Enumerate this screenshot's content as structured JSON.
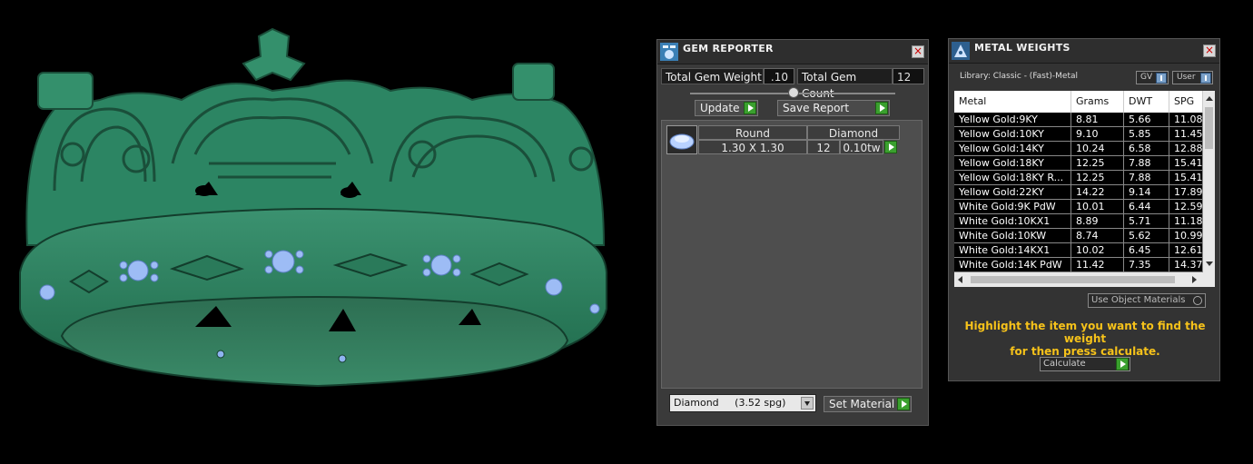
{
  "gem_reporter": {
    "title": "GEM REPORTER",
    "total_weight_label": "Total Gem Weight",
    "total_weight_value": ".10",
    "total_count_label": "Total Gem Count",
    "total_count_value": "12",
    "update_label": "Update",
    "save_report_label": "Save Report",
    "headers": [
      "Round",
      "Diamond"
    ],
    "row": {
      "size": "1.30 X 1.30",
      "count": "12",
      "weight": "0.10tw"
    },
    "material_select": "Diamond     (3.52 spg)",
    "set_material_label": "Set Material"
  },
  "metal_weights": {
    "title": "METAL WEIGHTS",
    "library_label": "Library: Classic - (Fast)-Metal",
    "gv_label": "GV",
    "user_label": "User",
    "columns": [
      "Metal",
      "Grams",
      "DWT",
      "SPG"
    ],
    "rows": [
      [
        "Yellow Gold:9KY",
        "8.81",
        "5.66",
        "11.08"
      ],
      [
        "Yellow Gold:10KY",
        "9.10",
        "5.85",
        "11.45"
      ],
      [
        "Yellow Gold:14KY",
        "10.24",
        "6.58",
        "12.88"
      ],
      [
        "Yellow Gold:18KY",
        "12.25",
        "7.88",
        "15.41"
      ],
      [
        "Yellow Gold:18KY R...",
        "12.25",
        "7.88",
        "15.41"
      ],
      [
        "Yellow Gold:22KY",
        "14.22",
        "9.14",
        "17.89"
      ],
      [
        "White Gold:9K PdW",
        "10.01",
        "6.44",
        "12.59"
      ],
      [
        "White Gold:10KX1",
        "8.89",
        "5.71",
        "11.18"
      ],
      [
        "White Gold:10KW",
        "8.74",
        "5.62",
        "10.99"
      ],
      [
        "White Gold:14KX1",
        "10.02",
        "6.45",
        "12.61"
      ],
      [
        "White Gold:14K PdW",
        "11.42",
        "7.35",
        "14.37"
      ]
    ],
    "use_object_materials": "Use Object Materials",
    "message_line1": "Highlight the item you want to find the weight",
    "message_line2": "for then press calculate.",
    "calculate_label": "Calculate"
  },
  "colors": {
    "crown": "#2a7a5a",
    "gem": "#8fb4f0",
    "accent_green": "#3aa02e",
    "message": "#f6c21a"
  },
  "icons": [
    "gem-reporter-icon",
    "metal-weights-icon",
    "close-icon",
    "play-icon",
    "info-icon",
    "dropdown-arrow-icon"
  ]
}
